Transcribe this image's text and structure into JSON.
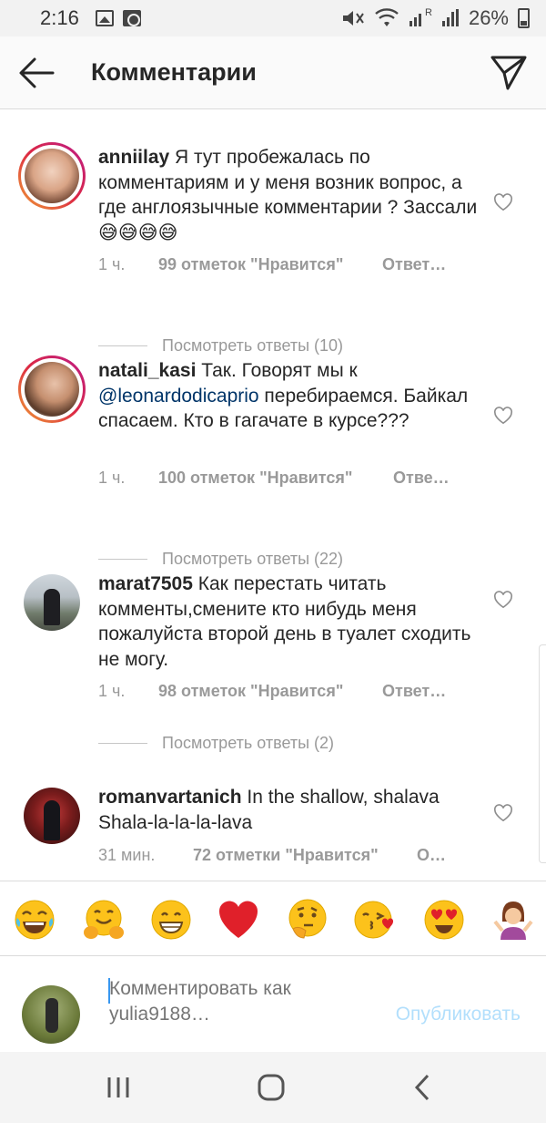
{
  "status_bar": {
    "time": "2:16",
    "battery": "26%",
    "signal_label": "R"
  },
  "header": {
    "title": "Комментарии"
  },
  "comments": [
    {
      "username": "anniilay",
      "text": " Я тут пробежалась по комментариям и у меня возник вопрос, а где англоязычные комментарии ? Зассали😅😅😅😅",
      "time": "1 ч.",
      "likes": "99 отметок \"Нравится\"",
      "reply": "Ответ…",
      "view_replies": "Посмотреть ответы (10)"
    },
    {
      "username": "natali_kasi",
      "text_before": " Так.  Говорят мы к ",
      "mention": "@leonardodicaprio",
      "text_after": "  перебираемся. Байкал спасаем. Кто в гагачате в курсе???",
      "time": "1 ч.",
      "likes": "100 отметок \"Нравится\"",
      "reply": "Отве…",
      "view_replies": "Посмотреть ответы (22)"
    },
    {
      "username": "marat7505",
      "text": " Как перестать читать комменты,смените кто нибудь меня пожалуйста  второй день в туалет сходить не могу.",
      "time": "1 ч.",
      "likes": "98 отметок \"Нравится\"",
      "reply": "Ответ…",
      "view_replies": "Посмотреть ответы (2)"
    },
    {
      "username": "romanvartanich",
      "text": " In the shallow, shalava Shala-la-la-la-lava",
      "time": "31 мин.",
      "likes": "72 отметки \"Нравится\"",
      "reply": "О…"
    }
  ],
  "emoji_bar": [
    "😂",
    "🤗",
    "😁",
    "❤️",
    "🤔",
    "😘",
    "😍",
    "🤷‍♀️"
  ],
  "composer": {
    "placeholder": "Комментировать как yulia9188…",
    "publish_label": "Опубликовать"
  },
  "colors": {
    "accent": "#3897f0",
    "publish_disabled": "#b2dffc",
    "mention": "#003569",
    "meta": "#999999"
  }
}
